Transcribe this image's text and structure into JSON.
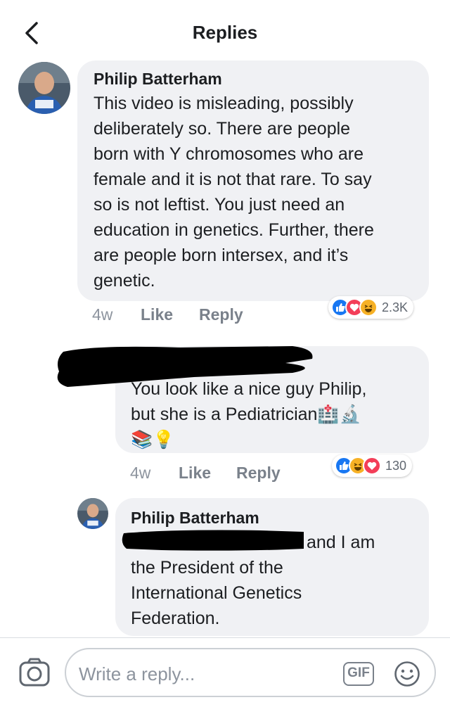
{
  "header": {
    "title": "Replies",
    "back_icon": "chevron-left-icon"
  },
  "comments": [
    {
      "author": "Philip Batterham",
      "lines": [
        "This video is misleading, possibly",
        "deliberately so.  There are people",
        "born with Y chromosomes who are",
        "female and it is not that rare. To say",
        "so is not leftist.  You just need an",
        "education in genetics.  Further, there",
        "are people born intersex, and it’s",
        "genetic."
      ],
      "time": "4w",
      "like_label": "Like",
      "reply_label": "Reply",
      "reactions": [
        "like",
        "love",
        "haha"
      ],
      "reaction_count": "2.3K"
    },
    {
      "author": "",
      "lines": [
        "You look like a nice guy Philip,",
        "but she is a Pediatrician🏥🔬",
        "📚💡"
      ],
      "time": "4w",
      "like_label": "Like",
      "reply_label": "Reply",
      "reactions": [
        "like",
        "haha",
        "love"
      ],
      "reaction_count": "130"
    },
    {
      "author": "Philip Batterham",
      "lines": [
        "and I am",
        "the President of the",
        "International Genetics",
        "Federation."
      ]
    }
  ],
  "footer": {
    "camera_icon": "camera-icon",
    "reply_placeholder": "Write a reply...",
    "gif_label": "GIF",
    "emoji_icon": "smiley-icon"
  },
  "colors": {
    "like": "#1877f2",
    "love": "#f33e58",
    "haha": "#f7b125",
    "bubble": "#f0f1f4",
    "meta": "#8d949e"
  }
}
